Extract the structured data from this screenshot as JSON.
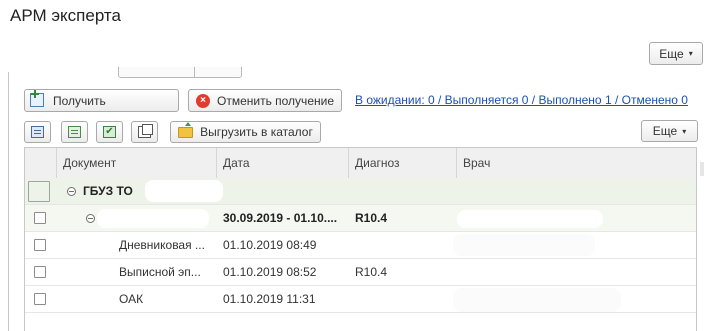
{
  "app": {
    "title": "АРМ эксперта"
  },
  "top_more": {
    "label": "Еще",
    "caret": "▾"
  },
  "actions": {
    "get_label": "Получить",
    "cancel_label": "Отменить получение",
    "cancel_icon_glyph": "×",
    "status_link": "В ожидании: 0 / Выполняется 0 / Выполнено 1 / Отменено 0"
  },
  "toolbar": {
    "check_glyph": "✔",
    "export_label": "Выгрузить в каталог",
    "more_label": "Еще",
    "more_caret": "▾"
  },
  "table": {
    "columns": [
      "Документ",
      "Дата",
      "Диагноз",
      "Врач"
    ],
    "group": {
      "document": "ГБУЗ ТО"
    },
    "subgroup": {
      "date": "30.09.2019 - 01.10....",
      "diagnosis": "R10.4"
    },
    "rows": [
      {
        "document": "Дневниковая ...",
        "date": "01.10.2019 08:49",
        "diagnosis": ""
      },
      {
        "document": "Выписной эп...",
        "date": "01.10.2019 08:52",
        "diagnosis": "R10.4"
      },
      {
        "document": "ОАК",
        "date": "01.10.2019 11:31",
        "diagnosis": ""
      }
    ]
  },
  "colors": {
    "link": "#1a4fb8",
    "group_row_bg": "#eef3ea",
    "cancel_icon": "#e23b2e"
  }
}
